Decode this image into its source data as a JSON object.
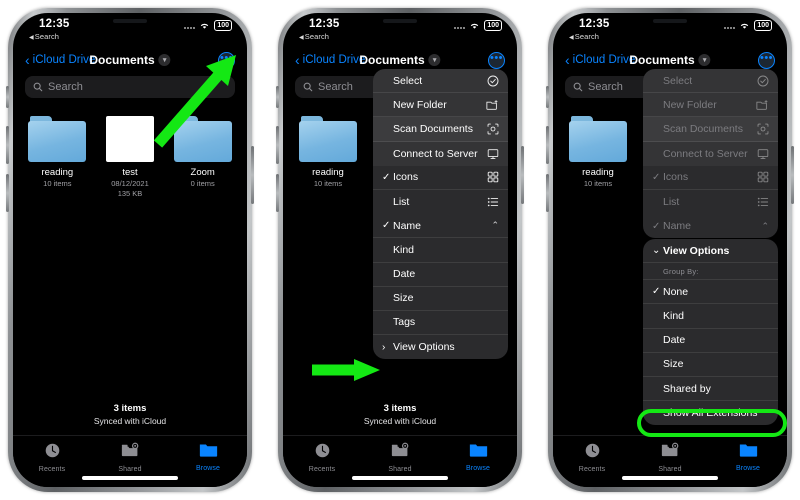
{
  "status_bar": {
    "time": "12:35",
    "back_label": "Search",
    "back_glyph": "◀",
    "battery": "100",
    "wifi_icon": "wifi-icon",
    "cellular_icon": "cellular-dots-icon"
  },
  "nav": {
    "back_label": "iCloud Drive",
    "title": "Documents",
    "title_chevron_icon": "chevron-down-icon",
    "more_icon": "ellipsis-icon",
    "more_glyph": "•••"
  },
  "search": {
    "placeholder": "Search",
    "icon": "search-icon"
  },
  "files": [
    {
      "name": "reading",
      "sub1": "10 items",
      "sub2": "",
      "type": "folder"
    },
    {
      "name": "test",
      "sub1": "08/12/2021",
      "sub2": "135 KB",
      "type": "document"
    },
    {
      "name": "Zoom",
      "sub1": "0 items",
      "sub2": "",
      "type": "folder"
    }
  ],
  "footer": {
    "count": "3 items",
    "sync": "Synced with iCloud"
  },
  "tabbar": [
    {
      "label": "Recents",
      "icon": "clock-icon",
      "active": false
    },
    {
      "label": "Shared",
      "icon": "shared-folder-person-icon",
      "active": false
    },
    {
      "label": "Browse",
      "icon": "folder-icon",
      "active": true
    }
  ],
  "context_menu": {
    "items": [
      {
        "label": "Select",
        "icon": "checkmark-circle-icon",
        "check": "",
        "caret": ""
      },
      {
        "label": "New Folder",
        "icon": "folder-plus-icon",
        "check": "",
        "caret": ""
      },
      {
        "label": "Scan Documents",
        "icon": "scan-document-icon",
        "check": "",
        "caret": ""
      },
      {
        "label": "Connect to Server",
        "icon": "monitor-icon",
        "check": "",
        "caret": ""
      },
      {
        "label": "Icons",
        "icon": "grid-icon",
        "check": "✓",
        "caret": ""
      },
      {
        "label": "List",
        "icon": "list-icon",
        "check": "",
        "caret": ""
      },
      {
        "label": "Name",
        "icon": "",
        "check": "✓",
        "caret": "⌃"
      },
      {
        "label": "Kind",
        "icon": "",
        "check": "",
        "caret": ""
      },
      {
        "label": "Date",
        "icon": "",
        "check": "",
        "caret": ""
      },
      {
        "label": "Size",
        "icon": "",
        "check": "",
        "caret": ""
      },
      {
        "label": "Tags",
        "icon": "",
        "check": "",
        "caret": ""
      },
      {
        "label": "View Options",
        "icon": "",
        "check": "›",
        "caret": ""
      }
    ]
  },
  "view_options_submenu": {
    "header": {
      "label": "View Options",
      "chevron": "⌄"
    },
    "group_by_label": "Group By:",
    "items": [
      {
        "label": "None",
        "check": "✓"
      },
      {
        "label": "Kind",
        "check": ""
      },
      {
        "label": "Date",
        "check": ""
      },
      {
        "label": "Size",
        "check": ""
      },
      {
        "label": "Shared by",
        "check": ""
      },
      {
        "label": "Show All Extensions",
        "check": ""
      }
    ]
  },
  "annotations": {
    "arrow_1_name": "green-arrow-to-more-button",
    "arrow_2_name": "green-arrow-to-view-options",
    "ring_name": "green-highlight-show-all-extensions",
    "accent_green": "#14e814"
  }
}
